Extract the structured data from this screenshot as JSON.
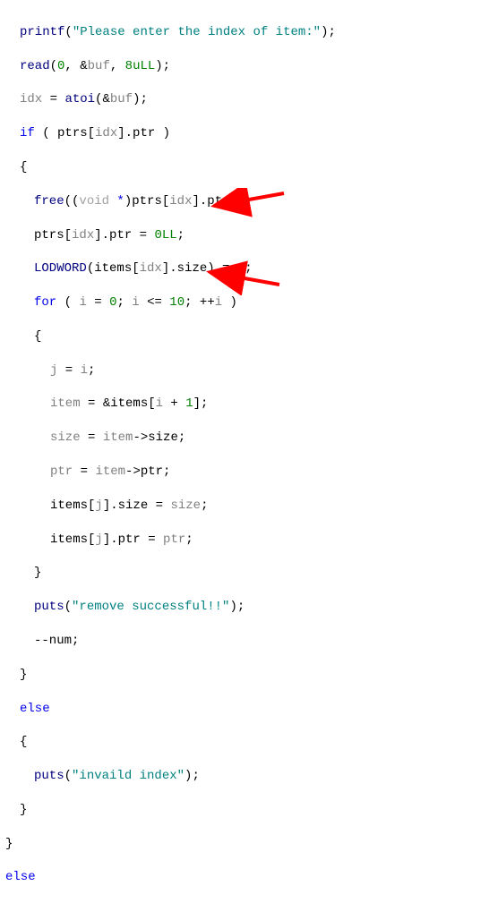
{
  "code": {
    "l1_fn": "printf",
    "l1_str": "\"Please enter the index of item:\"",
    "l2_fn": "read",
    "l2_arg1": "0",
    "l2_arg2_amp": "&",
    "l2_arg2_id": "buf",
    "l2_arg3": "8uLL",
    "l3_lhs": "idx",
    "l3_eq": " = ",
    "l3_fn": "atoi",
    "l3_amp": "&",
    "l3_arg": "buf",
    "l4_if": "if",
    "l4_cond_a": " ( ptrs[",
    "l4_cond_b": "idx",
    "l4_cond_c": "].ptr )",
    "l5_brace": "{",
    "l6_fn": "free",
    "l6_cast_a": "((",
    "l6_cast_void": "void",
    "l6_cast_star": " *",
    "l6_cast_b": ")ptrs[",
    "l6_idx": "idx",
    "l6_tail": "].ptr);",
    "l7_a": "ptrs[",
    "l7_idx": "idx",
    "l7_b": "].ptr = ",
    "l7_val": "0LL",
    "l7_semi": ";",
    "l8_fn": "LODWORD",
    "l8_a": "(items[",
    "l8_idx": "idx",
    "l8_b": "].size) = ",
    "l8_val": "0",
    "l8_semi": ";",
    "l9_for": "for",
    "l9_a": " ( ",
    "l9_i1": "i",
    "l9_eq": " = ",
    "l9_z": "0",
    "l9_semi1": "; ",
    "l9_i2": "i",
    "l9_cmp": " <= ",
    "l9_ten": "10",
    "l9_semi2": "; ++",
    "l9_i3": "i",
    "l9_close": " )",
    "l10_brace": "{",
    "l11_j": "j",
    "l11_eq": " = ",
    "l11_i": "i",
    "l11_semi": ";",
    "l12_item": "item",
    "l12_eq": " = &items[",
    "l12_i": "i",
    "l12_plus": " + ",
    "l12_one": "1",
    "l12_close": "];",
    "l13_size": "size",
    "l13_eq": " = ",
    "l13_item": "item",
    "l13_arrow": "->size;",
    "l14_ptr": "ptr",
    "l14_eq": " = ",
    "l14_item": "item",
    "l14_arrow": "->ptr;",
    "l15_a": "items[",
    "l15_j": "j",
    "l15_b": "].size = ",
    "l15_size": "size",
    "l15_semi": ";",
    "l16_a": "items[",
    "l16_j": "j",
    "l16_b": "].ptr = ",
    "l16_ptr": "ptr",
    "l16_semi": ";",
    "l17_brace": "}",
    "l18_fn": "puts",
    "l18_str": "\"remove successful!!\"",
    "l19": "--num;",
    "l20_brace": "}",
    "l21_else": "else",
    "l22_brace": "{",
    "l23_fn": "puts",
    "l23_str": "\"invaild index\"",
    "l24_brace": "}",
    "l25_brace": "}",
    "l26_else": "else"
  },
  "arrows": {
    "color": "#ff0000"
  }
}
